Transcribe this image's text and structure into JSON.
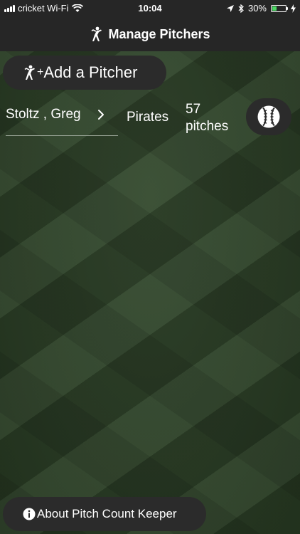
{
  "status_bar": {
    "carrier": "cricket Wi-Fi",
    "time": "10:04",
    "battery": "30%",
    "battery_level": 0.3
  },
  "nav": {
    "title": "Manage Pitchers"
  },
  "add_pitcher": {
    "label": "Add a Pitcher",
    "plus": "+"
  },
  "pitchers": [
    {
      "name": "Stoltz , Greg",
      "team": "Pirates",
      "count_number": "57",
      "count_unit": "pitches"
    }
  ],
  "about": {
    "label": "About Pitch Count Keeper"
  },
  "colors": {
    "nav_background": "#262626",
    "button_background": "#2b2b2b",
    "field_green": "#2f4529",
    "battery_green": "#4cd964"
  }
}
